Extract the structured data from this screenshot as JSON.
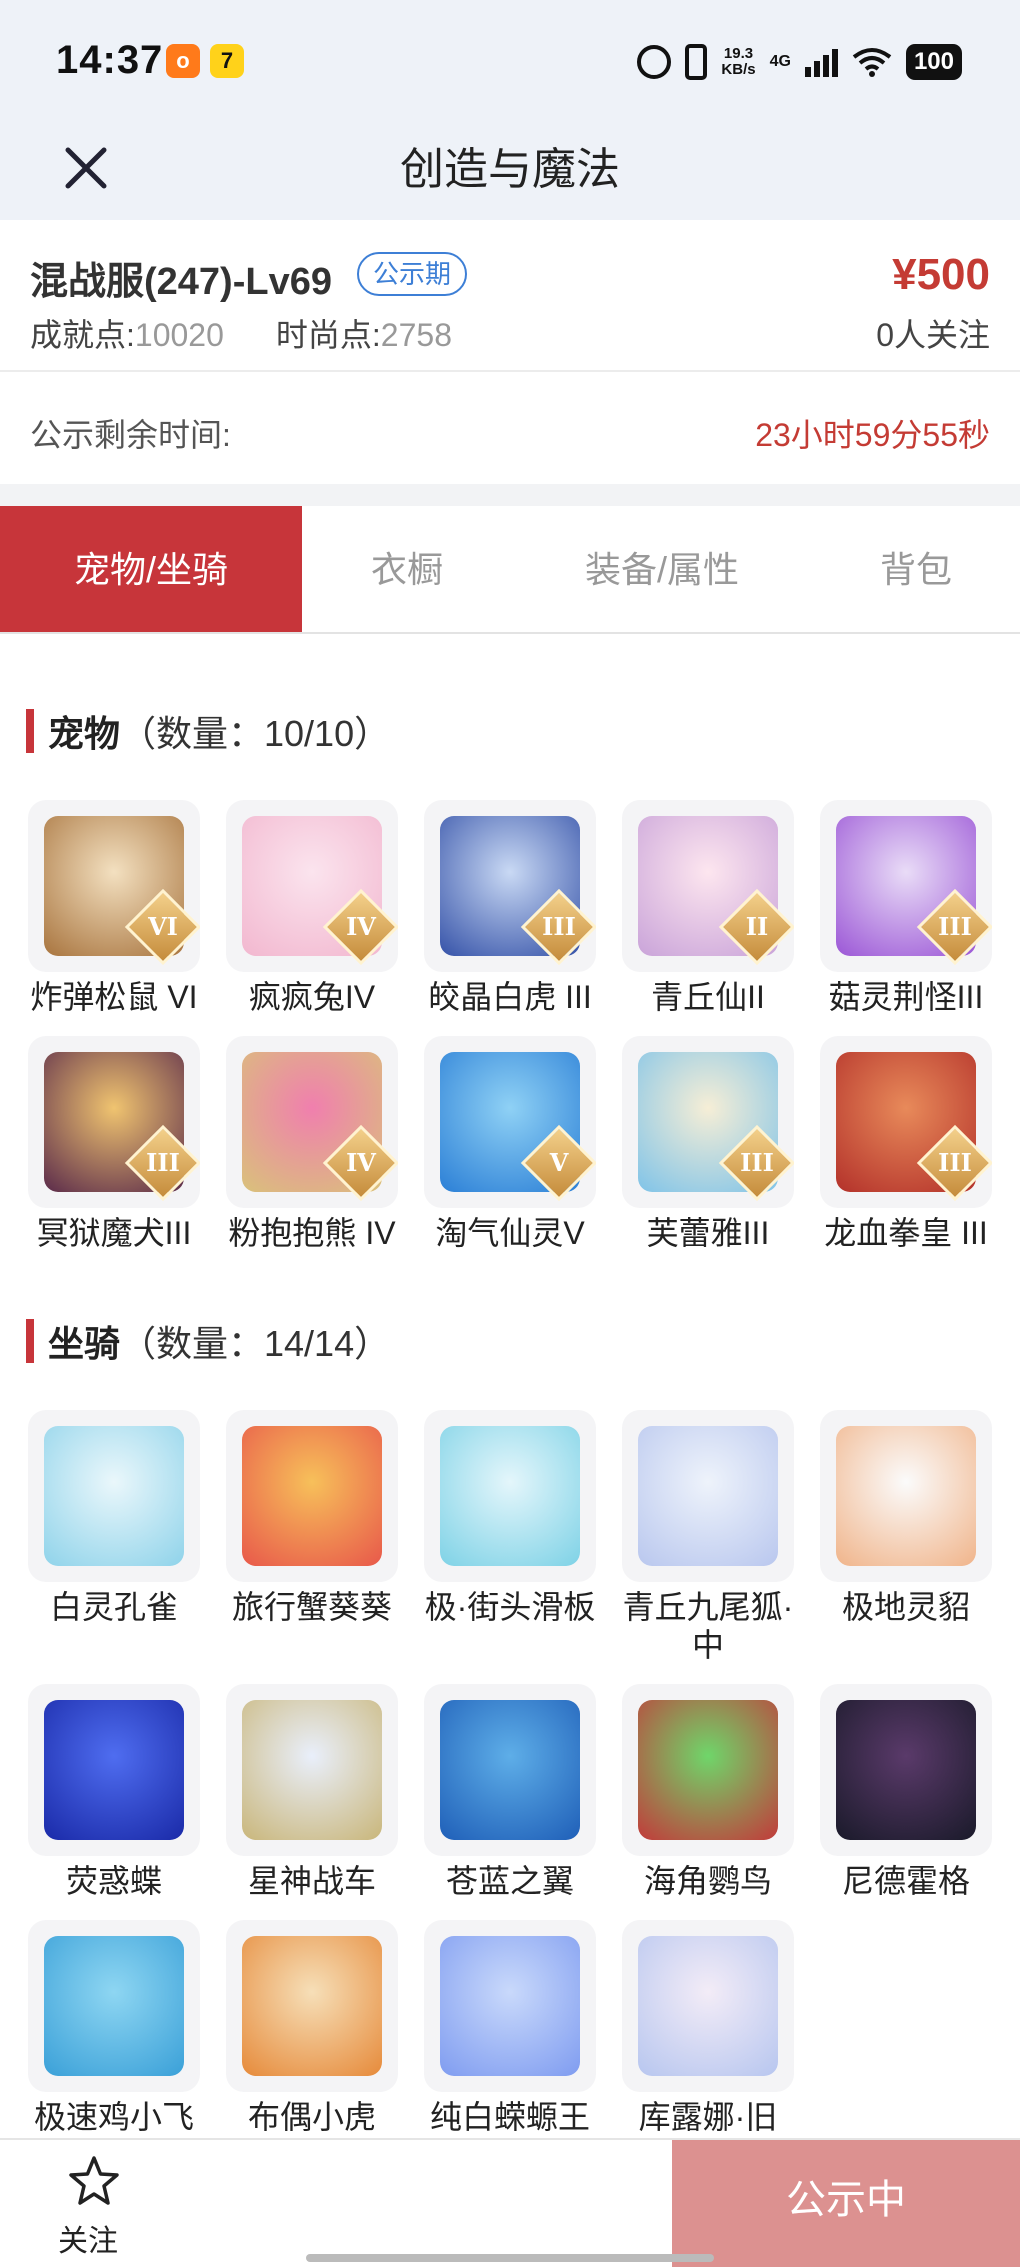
{
  "status_bar": {
    "time": "14:37",
    "app_badge_1": "o",
    "app_badge_2": "7",
    "speed_value": "19.3",
    "speed_unit": "KB/s",
    "network": "4G",
    "battery": "100"
  },
  "header": {
    "title": "创造与魔法"
  },
  "account": {
    "server": "混战服(247)-Lv69",
    "status_badge": "公示期",
    "achievement_label": "成就点:",
    "achievement_value": "10020",
    "fashion_label": "时尚点:",
    "fashion_value": "2758",
    "price": "¥500",
    "followers": "0人关注"
  },
  "remaining": {
    "label": "公示剩余时间:",
    "value": "23小时59分55秒"
  },
  "tabs": [
    {
      "label": "宠物/坐骑",
      "active": true
    },
    {
      "label": "衣橱"
    },
    {
      "label": "装备/属性"
    },
    {
      "label": "背包"
    }
  ],
  "pets_section": {
    "title": "宠物",
    "count": "（数量：10/10）",
    "items": [
      {
        "name": "炸弹松鼠 VI",
        "level": "VI",
        "colors": [
          "#f3e0c0",
          "#a8743e"
        ]
      },
      {
        "name": "疯疯兔IV",
        "level": "IV",
        "colors": [
          "#fbe4ee",
          "#f2b7cf"
        ]
      },
      {
        "name": "皎晶白虎 III",
        "level": "III",
        "colors": [
          "#c9d9f4",
          "#3552a8"
        ]
      },
      {
        "name": "青丘仙II",
        "level": "II",
        "colors": [
          "#fde6ef",
          "#c9a3d9"
        ]
      },
      {
        "name": "菇灵荆怪III",
        "level": "III",
        "colors": [
          "#e9dcf7",
          "#9b56d6"
        ]
      },
      {
        "name": "冥狱魔犬III",
        "level": "III",
        "colors": [
          "#f0c470",
          "#5a2a4a"
        ]
      },
      {
        "name": "粉抱抱熊 IV",
        "level": "IV",
        "colors": [
          "#f07fae",
          "#d9c27a"
        ]
      },
      {
        "name": "淘气仙灵V",
        "level": "V",
        "colors": [
          "#8fd1f5",
          "#2b7fd6"
        ]
      },
      {
        "name": "芙蕾雅III",
        "level": "III",
        "colors": [
          "#f6eed6",
          "#7fc3e8"
        ]
      },
      {
        "name": "龙血拳皇 III",
        "level": "III",
        "colors": [
          "#e88a5a",
          "#b3312a"
        ]
      }
    ]
  },
  "mounts_section": {
    "title": "坐骑",
    "count": "（数量：14/14）",
    "items": [
      {
        "name": "白灵孔雀",
        "colors": [
          "#eaf7fb",
          "#8fd3ea"
        ]
      },
      {
        "name": "旅行蟹葵葵",
        "colors": [
          "#f7c05a",
          "#e8584a"
        ]
      },
      {
        "name": "极·街头滑板",
        "colors": [
          "#e4f6fb",
          "#7ed2e6"
        ]
      },
      {
        "name": "青丘九尾狐·中",
        "colors": [
          "#eef3fb",
          "#b9c7ee"
        ]
      },
      {
        "name": "极地灵貂",
        "colors": [
          "#fbfbfb",
          "#f0b48a"
        ]
      },
      {
        "name": "荧惑蝶",
        "colors": [
          "#4f6df0",
          "#1a2aa8"
        ]
      },
      {
        "name": "星神战车",
        "colors": [
          "#e9effb",
          "#c9b67a"
        ]
      },
      {
        "name": "苍蓝之翼",
        "colors": [
          "#5eaee8",
          "#1f5fb8"
        ]
      },
      {
        "name": "海角鹦鸟",
        "colors": [
          "#6fd66a",
          "#c23a3a"
        ]
      },
      {
        "name": "尼德霍格",
        "colors": [
          "#5a3a6a",
          "#1a1a2a"
        ]
      },
      {
        "name": "极速鸡小飞",
        "colors": [
          "#8ed6f2",
          "#3aa0d8"
        ]
      },
      {
        "name": "布偶小虎",
        "colors": [
          "#f6dfb8",
          "#e68a3a"
        ]
      },
      {
        "name": "纯白蝾螈王",
        "colors": [
          "#c9d9fb",
          "#7f9cf0"
        ]
      },
      {
        "name": "库露娜·旧",
        "colors": [
          "#f3ecf7",
          "#b7c6ef"
        ]
      }
    ]
  },
  "bottom": {
    "follow_label": "关注",
    "status_button": "公示中"
  }
}
